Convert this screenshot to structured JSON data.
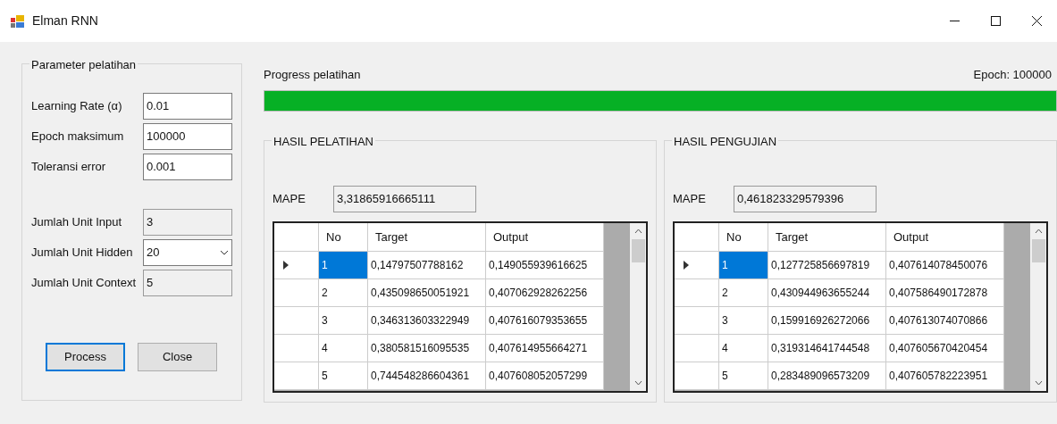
{
  "window": {
    "title": "Elman RNN"
  },
  "parameters": {
    "title": "Parameter pelatihan",
    "fields": [
      {
        "label": "Learning Rate (α)",
        "value": "0.01",
        "kind": "text"
      },
      {
        "label": "Epoch maksimum",
        "value": "100000",
        "kind": "text"
      },
      {
        "label": "Toleransi error",
        "value": "0.001",
        "kind": "text"
      },
      {
        "label": "Jumlah Unit Input",
        "value": "3",
        "kind": "readonly"
      },
      {
        "label": "Jumlah Unit Hidden",
        "value": "20",
        "kind": "combo"
      },
      {
        "label": "Jumlah Unit Context",
        "value": "5",
        "kind": "readonly"
      }
    ],
    "buttons": [
      {
        "label": "Process",
        "focused": true
      },
      {
        "label": "Close",
        "focused": false
      }
    ]
  },
  "progress": {
    "label": "Progress pelatihan",
    "epoch": "Epoch: 100000",
    "level": 1
  },
  "results": [
    {
      "title": "HASIL PELATIHAN",
      "mape_label": "MAPE",
      "mape": "3,31865916665111",
      "columns": [
        "No",
        "Target",
        "Output"
      ],
      "rows": [
        {
          "cells": [
            "1",
            "0,14797507788162",
            "0,149055939616625"
          ],
          "selected": true
        },
        {
          "cells": [
            "2",
            "0,435098650051921",
            "0,407062928262256"
          ],
          "selected": false
        },
        {
          "cells": [
            "3",
            "0,346313603322949",
            "0,407616079353655"
          ],
          "selected": false
        },
        {
          "cells": [
            "4",
            "0,380581516095535",
            "0,407614955664271"
          ],
          "selected": false
        },
        {
          "cells": [
            "5",
            "0,744548286604361",
            "0,407608052057299"
          ],
          "selected": false
        }
      ]
    },
    {
      "title": "HASIL PENGUJIAN",
      "mape_label": "MAPE",
      "mape": "0,461823329579396",
      "columns": [
        "No",
        "Target",
        "Output"
      ],
      "rows": [
        {
          "cells": [
            "1",
            "0,127725856697819",
            "0,407614078450076"
          ],
          "selected": true
        },
        {
          "cells": [
            "2",
            "0,430944963655244",
            "0,407586490172878"
          ],
          "selected": false
        },
        {
          "cells": [
            "3",
            "0,159916926272066",
            "0,407613074070866"
          ],
          "selected": false
        },
        {
          "cells": [
            "4",
            "0,319314641744548",
            "0,407605670420454"
          ],
          "selected": false
        },
        {
          "cells": [
            "5",
            "0,283489096573209",
            "0,407605782223951"
          ],
          "selected": false
        }
      ]
    }
  ]
}
